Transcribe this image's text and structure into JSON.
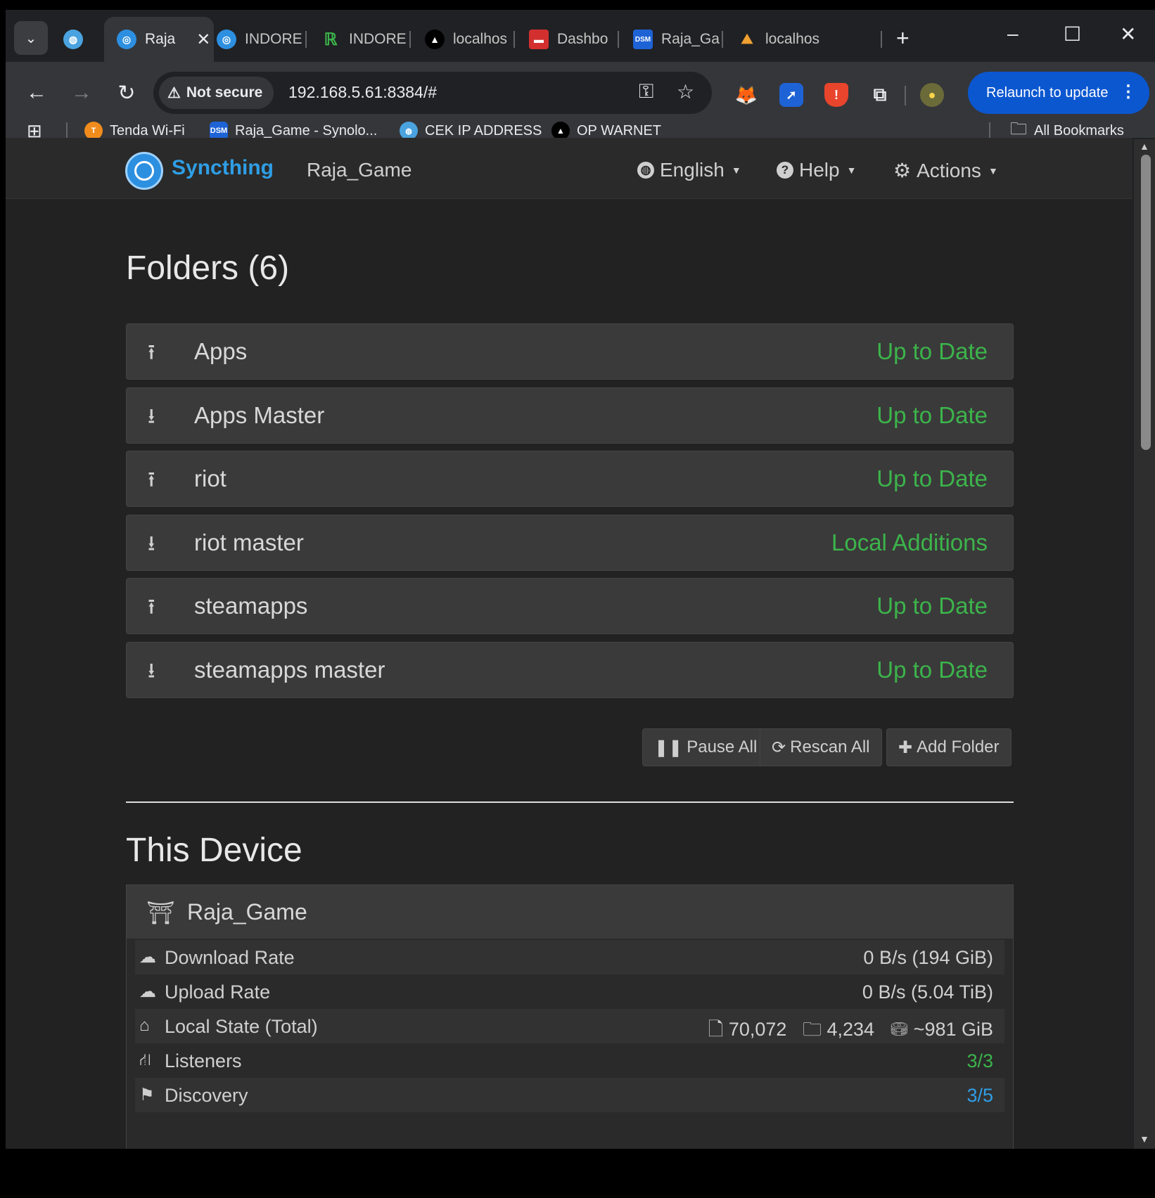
{
  "tabs": [
    {
      "label": "",
      "type": "globe"
    },
    {
      "label": "Raja",
      "type": "syncthing",
      "active": true
    },
    {
      "label": "INDORE",
      "type": "syncthing"
    },
    {
      "label": "INDORE",
      "type": "green-r"
    },
    {
      "label": "localhos",
      "type": "triangle"
    },
    {
      "label": "Dashbo",
      "type": "red"
    },
    {
      "label": "Raja_Ga",
      "type": "dsm"
    },
    {
      "label": "localhos",
      "type": "orange"
    }
  ],
  "tab_icons": {
    "dsm": "DSM",
    "new_tab": "+"
  },
  "toolbar": {
    "security_label": "Not secure",
    "url": "192.168.5.61:8384/#",
    "relaunch_label": "Relaunch to update"
  },
  "bookmarks": [
    {
      "label": "Tenda Wi-Fi",
      "icon": "tenda-icon",
      "color": "#f08c1c"
    },
    {
      "label": "Raja_Game - Synolo...",
      "icon": "dsm-icon",
      "color": "#1e63d6"
    },
    {
      "label": "CEK IP ADDRESS",
      "icon": "globe-icon",
      "color": "#4aa3df"
    },
    {
      "label": "OP WARNET",
      "icon": "triangle-icon",
      "color": "#000000"
    }
  ],
  "all_bookmarks_label": "All Bookmarks",
  "navbar": {
    "brand": "Syncthing",
    "device": "Raja_Game",
    "language": "English",
    "help": "Help",
    "actions": "Actions"
  },
  "folders_section": {
    "title": "Folders (6)",
    "items": [
      {
        "name": "Apps",
        "status": "Up to Date",
        "direction": "upload"
      },
      {
        "name": "Apps Master",
        "status": "Up to Date",
        "direction": "download"
      },
      {
        "name": "riot",
        "status": "Up to Date",
        "direction": "upload"
      },
      {
        "name": "riot master",
        "status": "Local Additions",
        "direction": "download"
      },
      {
        "name": "steamapps",
        "status": "Up to Date",
        "direction": "upload"
      },
      {
        "name": "steamapps master",
        "status": "Up to Date",
        "direction": "download"
      }
    ],
    "buttons": {
      "pause_all": "Pause All",
      "rescan_all": "Rescan All",
      "add_folder": "Add Folder"
    }
  },
  "device_section": {
    "title": "This Device",
    "device_name": "Raja_Game",
    "rows": {
      "download_rate": {
        "label": "Download Rate",
        "value": "0 B/s (194 GiB)"
      },
      "upload_rate": {
        "label": "Upload Rate",
        "value": "0 B/s (5.04 TiB)"
      },
      "local_state": {
        "label": "Local State (Total)",
        "files": "70,072",
        "dirs": "4,234",
        "size": "~981 GiB"
      },
      "listeners": {
        "label": "Listeners",
        "value": "3/3"
      },
      "discovery": {
        "label": "Discovery",
        "value": "3/5"
      }
    }
  },
  "colors": {
    "status_green": "#3cb44b",
    "link_blue": "#2f9ee5",
    "accent": "#0b57d0"
  }
}
